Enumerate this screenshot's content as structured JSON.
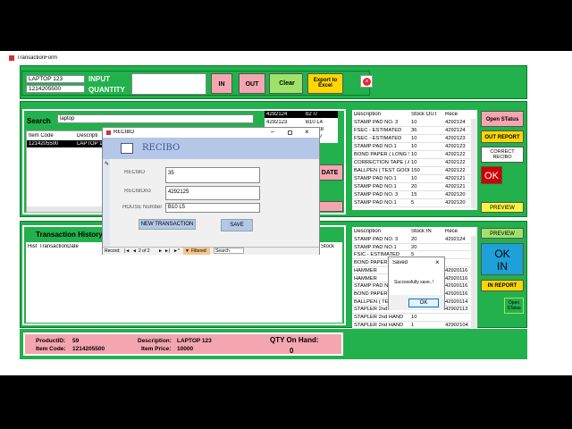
{
  "window": {
    "title": "TransactionForm"
  },
  "top": {
    "item_field": "LAPTOP 123",
    "code_field": "1214205500",
    "input_label": "INPUT",
    "quantity_label": "QUANTITY",
    "in_label": "IN",
    "out_label": "OUT",
    "clear_label": "Clear",
    "export_label_1": "Export to",
    "export_label_2": "Excel"
  },
  "search": {
    "label": "Search",
    "value": "laptop",
    "col_item_code": "Item Code",
    "col_description": "Descripti",
    "row_code": "1214205500",
    "row_desc": "LAPTOP 1"
  },
  "mini_list": {
    "rows": [
      {
        "a": "4292124",
        "b": "b2 I7"
      },
      {
        "a": "4292123",
        "b": "B10 L4"
      },
      {
        "a": "",
        "b": "ct8"
      },
      {
        "a": "",
        "b": "17"
      }
    ]
  },
  "update_button": "DATE",
  "recibo": {
    "window_title": "RECIBO",
    "header": "RECIBO",
    "label_recibo": "RECIBO",
    "value_recibo": "35",
    "label_recibo_no": "RECIBOno",
    "value_recibo_no": "4292125",
    "label_house": "HOUSE Number",
    "value_house": "B10 L5",
    "new_transaction": "NEW TRANSACTION",
    "save": "SAVE",
    "nav_record": "Record:",
    "nav_pos": "2 of 2",
    "nav_filtered": "Filtered",
    "nav_search": "Search"
  },
  "out_table": {
    "headers": [
      "Description",
      "Stock OUT",
      "Rece"
    ],
    "rows": [
      [
        "STAMP PAD NO. 3",
        "10",
        "4292124"
      ],
      [
        "FSEC - ESTIMATED",
        "36",
        "4292124"
      ],
      [
        "FSEC - ESTIMATED",
        "10",
        "4292123"
      ],
      [
        "STAMP PAD NO.1",
        "10",
        "4292123"
      ],
      [
        "BOND PAPER ( LONG S",
        "10",
        "4292122"
      ],
      [
        "CORRECTION TAPE ( A",
        "10",
        "4292122"
      ],
      [
        "BALLPEN ( TEST GOOD",
        "150",
        "4292122"
      ],
      [
        "STAMP PAD NO.1",
        "10",
        "4292121"
      ],
      [
        "STAMP PAD NO.1",
        "20",
        "4292121"
      ],
      [
        "STAMP PAD NO. 3",
        "15",
        "4292120"
      ],
      [
        "STAMP PAD NO.1",
        "5",
        "4292120"
      ]
    ]
  },
  "right_top": {
    "open_status": "Open STatus",
    "out_report": "OUT REPORT",
    "correct_recibo_1": "CORRECT",
    "correct_recibo_2": "RECIBO",
    "ok": "OK",
    "preview": "PREVIEW"
  },
  "history": {
    "title": "Transaction History",
    "col_hist": "Hist",
    "col_date": "TransactionDate",
    "col_stock": "Stock"
  },
  "in_table": {
    "headers": [
      "Description",
      "Stock IN",
      "Rece"
    ],
    "rows": [
      [
        "STAMP PAD NO. 3",
        "20",
        "4292124"
      ],
      [
        "STAMP PAD NO.1",
        "20",
        ""
      ],
      [
        "FSIC - ESTIMATED",
        "5",
        ""
      ],
      [
        "BOND PAPER",
        "",
        ""
      ],
      [
        "HAMMER",
        "",
        "42920116"
      ],
      [
        "HAMMER",
        "",
        "42920116"
      ],
      [
        "STAMP PAD N",
        "",
        "42920116"
      ],
      [
        "BOND PAPER",
        "",
        "42920116"
      ],
      [
        "BALLPEN ( TE",
        "",
        "42920114"
      ],
      [
        "STAPLER 2nd",
        "",
        "42902113"
      ],
      [
        "STAPLER 2nd HAND",
        "10",
        ""
      ],
      [
        "STAPLER 2nd HAND",
        "1",
        "42902104"
      ],
      [
        "PENTELPEN INK - PILO",
        "6",
        "42902104"
      ],
      [
        "STAPLER MAX HD-50R",
        "4",
        "42902104"
      ]
    ]
  },
  "right_bottom": {
    "preview": "PREVIEW",
    "ok": "OK",
    "in": "IN",
    "in_report": "IN REPORT",
    "open_status_1": "Open",
    "open_status_2": "STatus"
  },
  "saved_dialog": {
    "title": "Saved",
    "message": "Successfully save..!",
    "ok": "OK",
    "close": "×"
  },
  "product": {
    "id_label": "ProductID:",
    "id_value": "59",
    "code_label": "Item Code:",
    "code_value": "1214205500",
    "desc_label": "Description:",
    "desc_value": "LAPTOP 123",
    "price_label": "Item Price:",
    "price_value": "10000",
    "qty_label": "QTY On Hand:",
    "qty_value": "0"
  },
  "colors": {
    "panel_green": "#22b14c",
    "button_pink": "#f4a6b0",
    "button_yellow": "#ffd700",
    "ok_red": "#cc0000",
    "preview_yellow": "#f5f542"
  }
}
